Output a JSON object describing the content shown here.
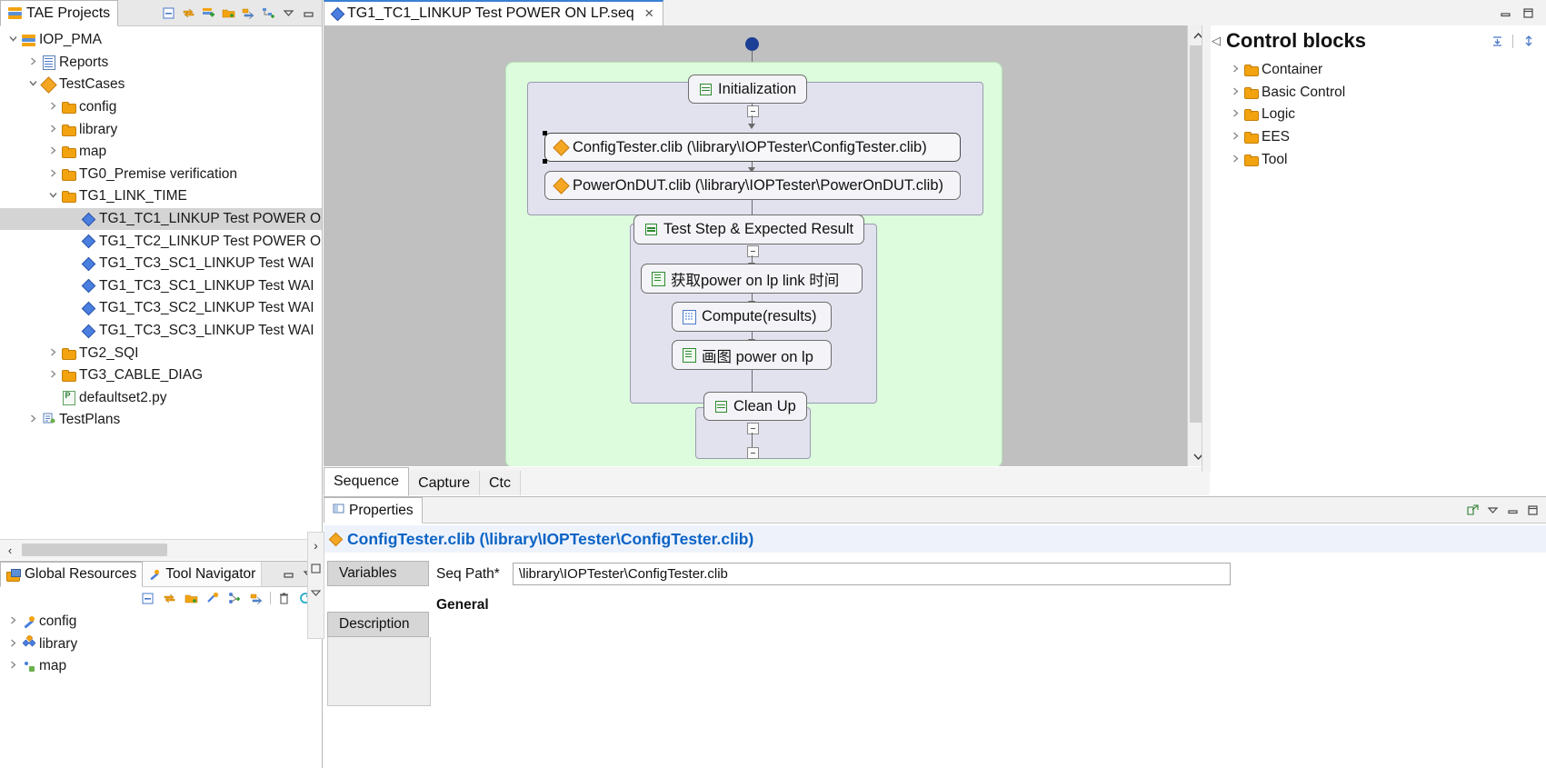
{
  "project_explorer": {
    "tab_label": "TAE Projects",
    "toolbar_icons": [
      "collapse-all-icon",
      "link-with-editor-icon",
      "add-project-icon",
      "new-folder-icon",
      "import-icon",
      "hierarchy-icon",
      "view-menu-icon",
      "minimize-icon"
    ],
    "tree": [
      {
        "label": "IOP_PMA",
        "depth": 0,
        "twisty": "v",
        "icon": "layers-icon",
        "selected": false
      },
      {
        "label": "Reports",
        "depth": 1,
        "twisty": ">",
        "icon": "document-icon",
        "selected": false
      },
      {
        "label": "TestCases",
        "depth": 1,
        "twisty": "v",
        "icon": "diamond-orange-icon",
        "selected": false
      },
      {
        "label": "config",
        "depth": 2,
        "twisty": ">",
        "icon": "folder-icon",
        "selected": false
      },
      {
        "label": "library",
        "depth": 2,
        "twisty": ">",
        "icon": "folder-icon",
        "selected": false
      },
      {
        "label": "map",
        "depth": 2,
        "twisty": ">",
        "icon": "folder-icon",
        "selected": false
      },
      {
        "label": "TG0_Premise verification",
        "depth": 2,
        "twisty": ">",
        "icon": "folder-icon",
        "selected": false
      },
      {
        "label": "TG1_LINK_TIME",
        "depth": 2,
        "twisty": "v",
        "icon": "folder-icon",
        "selected": false
      },
      {
        "label": "TG1_TC1_LINKUP Test POWER O",
        "depth": 3,
        "twisty": "",
        "icon": "diamond-blue-icon",
        "selected": true
      },
      {
        "label": "TG1_TC2_LINKUP Test POWER O",
        "depth": 3,
        "twisty": "",
        "icon": "diamond-blue-icon",
        "selected": false
      },
      {
        "label": "TG1_TC3_SC1_LINKUP Test WAI",
        "depth": 3,
        "twisty": "",
        "icon": "diamond-blue-icon",
        "selected": false
      },
      {
        "label": "TG1_TC3_SC1_LINKUP Test WAI",
        "depth": 3,
        "twisty": "",
        "icon": "diamond-blue-icon",
        "selected": false
      },
      {
        "label": "TG1_TC3_SC2_LINKUP Test WAI",
        "depth": 3,
        "twisty": "",
        "icon": "diamond-blue-icon",
        "selected": false
      },
      {
        "label": "TG1_TC3_SC3_LINKUP Test WAI",
        "depth": 3,
        "twisty": "",
        "icon": "diamond-blue-icon",
        "selected": false
      },
      {
        "label": "TG2_SQI",
        "depth": 2,
        "twisty": ">",
        "icon": "folder-icon",
        "selected": false
      },
      {
        "label": "TG3_CABLE_DIAG",
        "depth": 2,
        "twisty": ">",
        "icon": "folder-icon",
        "selected": false
      },
      {
        "label": "defaultset2.py",
        "depth": 2,
        "twisty": "",
        "icon": "python-file-icon",
        "selected": false
      },
      {
        "label": "TestPlans",
        "depth": 1,
        "twisty": ">",
        "icon": "testplans-icon",
        "selected": false
      }
    ]
  },
  "bottom_left": {
    "tabs": [
      {
        "label": "Global Resources",
        "icon": "global-resources-icon",
        "active": true
      },
      {
        "label": "Tool Navigator",
        "icon": "wrench-icon",
        "active": false
      }
    ],
    "toolbar_icons": [
      "collapse-all-icon",
      "refresh-link-icon",
      "new-folder-icon",
      "tool-icon",
      "link-icon",
      "import-icon",
      "delete-icon",
      "refresh-icon"
    ],
    "tree": [
      {
        "label": "config",
        "twisty": ">",
        "icon": "wrench-icon"
      },
      {
        "label": "library",
        "twisty": ">",
        "icon": "diamond-cluster-icon"
      },
      {
        "label": "map",
        "twisty": ">",
        "icon": "map-icon"
      }
    ]
  },
  "editor": {
    "tab": {
      "label": "TG1_TC1_LINKUP Test POWER ON LP.seq",
      "icon": "diamond-blue-icon",
      "close_label": "✕"
    },
    "bottom_tabs": [
      {
        "label": "Sequence",
        "active": true
      },
      {
        "label": "Capture",
        "active": false
      },
      {
        "label": "Ctc",
        "active": false
      }
    ],
    "diagram": {
      "start_node": "start-dot",
      "nodes": [
        {
          "id": "initialization",
          "label": "Initialization",
          "icon": "sequence-block-icon"
        },
        {
          "id": "config_tester",
          "label": "ConfigTester.clib (\\library\\IOPTester\\ConfigTester.clib)",
          "icon": "diamond-orange-icon",
          "selected": true
        },
        {
          "id": "power_on_dut",
          "label": "PowerOnDUT.clib (\\library\\IOPTester\\PowerOnDUT.clib)",
          "icon": "diamond-orange-icon",
          "selected": false
        },
        {
          "id": "test_step",
          "label": "Test Step & Expected Result",
          "icon": "sequence-block-icon"
        },
        {
          "id": "get_power",
          "label": "获取power on lp link 时间",
          "icon": "script-icon"
        },
        {
          "id": "compute",
          "label": "Compute(results)",
          "icon": "calculator-icon"
        },
        {
          "id": "plot",
          "label": "画图 power on lp",
          "icon": "script-icon"
        },
        {
          "id": "clean_up",
          "label": "Clean Up",
          "icon": "sequence-block-icon"
        }
      ]
    }
  },
  "control_blocks": {
    "title": "Control blocks",
    "toolbar_icons": [
      "collapse-all-icon",
      "pin-icon"
    ],
    "items": [
      {
        "label": "Container",
        "twisty": ">",
        "icon": "folder-icon"
      },
      {
        "label": "Basic Control",
        "twisty": ">",
        "icon": "folder-icon"
      },
      {
        "label": "Logic",
        "twisty": ">",
        "icon": "folder-icon"
      },
      {
        "label": "EES",
        "twisty": ">",
        "icon": "folder-icon"
      },
      {
        "label": "Tool",
        "twisty": ">",
        "icon": "folder-icon"
      }
    ]
  },
  "properties": {
    "tab_label": "Properties",
    "tab_icon": "properties-icon",
    "title": "ConfigTester.clib (\\library\\IOPTester\\ConfigTester.clib)",
    "title_icon": "diamond-orange-icon",
    "vtabs": [
      {
        "label": "Variables",
        "active": true
      },
      {
        "label": "Description",
        "active": false
      }
    ],
    "field_label": "Seq Path*",
    "field_value": "\\library\\IOPTester\\ConfigTester.clib",
    "section_label": "General",
    "toolbar_icons": [
      "restore-icon",
      "view-menu-icon",
      "minimize-icon",
      "maximize-icon"
    ]
  },
  "window": {
    "minimize_label": "—",
    "maximize_label": "❐"
  }
}
